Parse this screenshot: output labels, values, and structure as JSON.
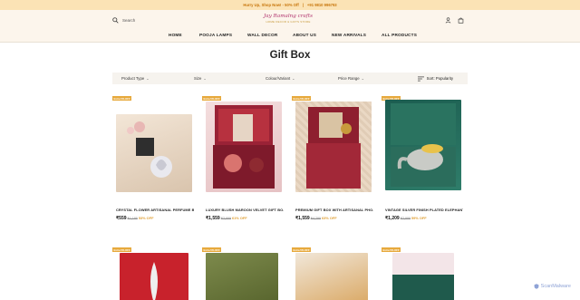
{
  "promo": {
    "text": "Hurry Up, Shop Now! - 50% Off",
    "phone": "+91 9810 996793"
  },
  "header": {
    "search_placeholder": "Search",
    "logo_brand": "Jay Ramalng crafts",
    "logo_tagline": "HOME DECOR & GIFTS STORE",
    "icons": [
      "search-icon",
      "user-icon",
      "cart-icon"
    ]
  },
  "nav": [
    "HOME",
    "POOJA LAMPS",
    "WALL DECOR",
    "ABOUT US",
    "NEW ARRIVALS",
    "ALL PRODUCTS"
  ],
  "page_title": "Gift Box",
  "filters": {
    "product_type": "Product Type",
    "size": "Size",
    "color": "Colour/Variant",
    "price": "Price Range",
    "sort": "Sort: Popularity"
  },
  "products": [
    {
      "badge": "Extra 5% OFF",
      "name": "CRYSTAL FLOWER ARTISANAL PERFUME B...",
      "price": "₹559",
      "mrp": "₹1,199",
      "off": "53% OFF",
      "img_accent": "#3a3a3a"
    },
    {
      "badge": "Extra 5% OFF",
      "name": "LUXURY BLUSH MAROON VELVET GIFT BO...",
      "price": "₹1,559",
      "mrp": "₹3,999",
      "off": "61% OFF",
      "img_accent": "#b33b4c"
    },
    {
      "badge": "Extra 5% OFF",
      "name": "PREMIUM GIFT BOX WITH ARTISANAL PHO...",
      "price": "₹1,559",
      "mrp": "₹4,299",
      "off": "63% OFF",
      "img_accent": "#8e1f2f"
    },
    {
      "badge": "Extra 5% OFF",
      "name": "VINTAGE SILVER FINISH PLATED ELEPHANT ...",
      "price": "₹1,209",
      "mrp": "₹2,999",
      "off": "59% OFF",
      "img_accent": "#2f7d6a"
    }
  ],
  "products_row2": [
    {
      "badge": "Extra 5% OFF",
      "img_accent": "#c8222c"
    },
    {
      "badge": "Extra 5% OFF",
      "img_accent": "#6b7a3c"
    },
    {
      "badge": "Extra 5% OFF",
      "img_accent": "#d9a660"
    },
    {
      "badge": "Extra 5% OFF",
      "img_accent": "#1f5a4c"
    }
  ],
  "watermark": "ScanMalware"
}
